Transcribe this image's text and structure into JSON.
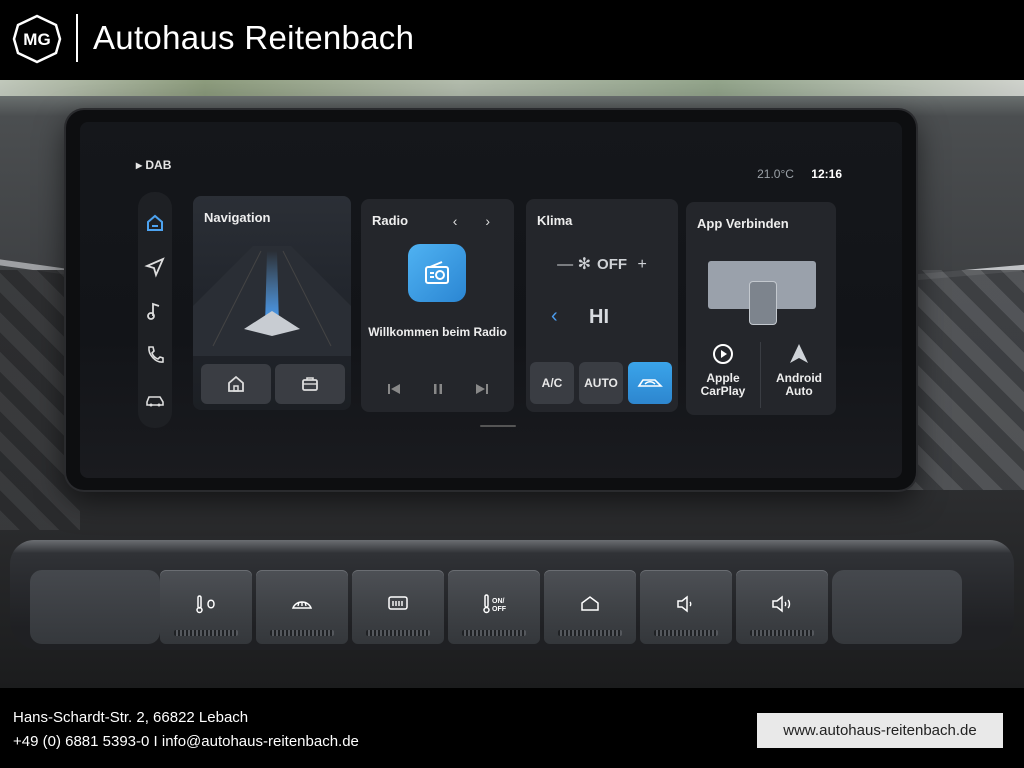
{
  "header": {
    "brand": "MG",
    "dealer_name": "Autohaus Reitenbach"
  },
  "screen": {
    "status": {
      "source": "DAB",
      "temperature": "21.0°C",
      "time": "12:16"
    },
    "rail_icons": [
      "home-icon",
      "navigation-arrow-icon",
      "music-note-icon",
      "phone-icon",
      "car-icon"
    ],
    "navigation": {
      "title": "Navigation"
    },
    "radio": {
      "title": "Radio",
      "welcome": "Willkommen beim Radio"
    },
    "klima": {
      "title": "Klima",
      "fan_state": "OFF",
      "temp_setting": "HI",
      "btn_ac": "A/C",
      "btn_auto": "AUTO"
    },
    "app": {
      "title": "App Verbinden",
      "carplay": "Apple CarPlay",
      "android": "Android Auto"
    }
  },
  "console_icons": [
    "seat-heat-fan-icon",
    "front-defrost-icon",
    "rear-defrost-icon",
    "climate-onoff-icon",
    "home-icon",
    "volume-down-icon",
    "volume-up-icon"
  ],
  "footer": {
    "address": "Hans-Schardt-Str. 2, 66822 Lebach",
    "contact": "+49 (0) 6881 5393-0  I  info@autohaus-reitenbach.de",
    "website": "www.autohaus-reitenbach.de"
  }
}
